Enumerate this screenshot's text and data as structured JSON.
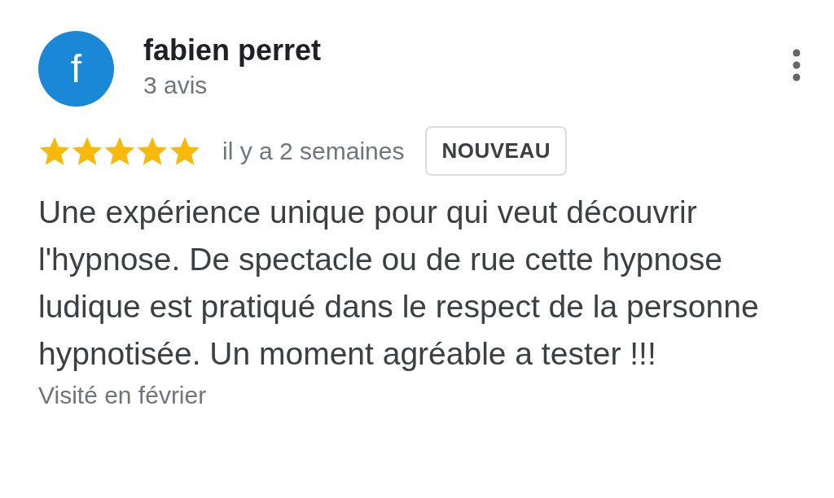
{
  "review": {
    "avatar_letter": "f",
    "author": "fabien perret",
    "review_count": "3 avis",
    "stars": 5,
    "time": "il y a 2 semaines",
    "badge": "NOUVEAU",
    "text": "Une expérience unique pour qui veut découvrir l'hypnose. De spectacle ou de rue cette hypnose ludique est pratiqué dans le respect de la personne hypnotisée. Un moment agréable a tester !!!",
    "visited": "Visité en février"
  }
}
